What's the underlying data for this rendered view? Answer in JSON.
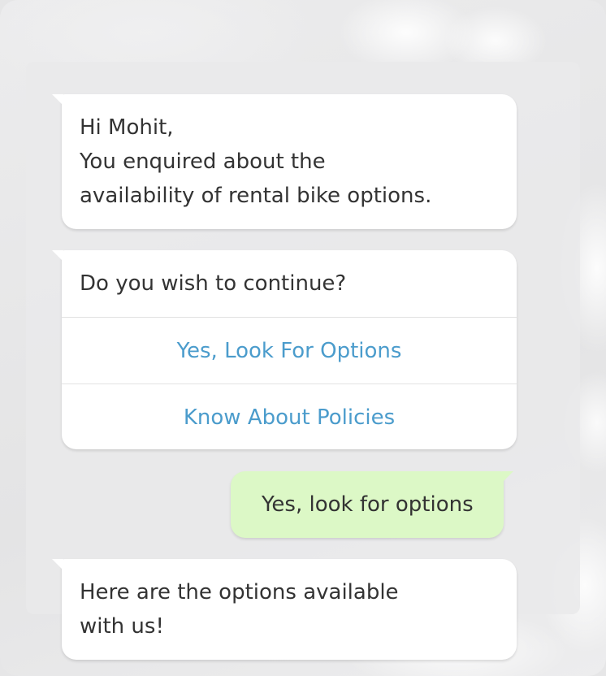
{
  "messages": [
    {
      "id": "greeting",
      "sender": "bot",
      "text": "Hi Mohit,\nYou enquired about the\navailability of rental bike options."
    },
    {
      "id": "question",
      "sender": "bot",
      "text": "Do you wish to continue?",
      "options": [
        {
          "label": "Yes, Look For Options"
        },
        {
          "label": "Know About Policies"
        }
      ]
    },
    {
      "id": "user-reply",
      "sender": "user",
      "text": "Yes, look for options"
    },
    {
      "id": "options-intro",
      "sender": "bot",
      "text": " Here are the options available\nwith us!"
    }
  ],
  "colors": {
    "bot_bubble": "#ffffff",
    "user_bubble": "#dcf8c6",
    "option_text": "#4b9ccc",
    "message_text": "#333333"
  }
}
